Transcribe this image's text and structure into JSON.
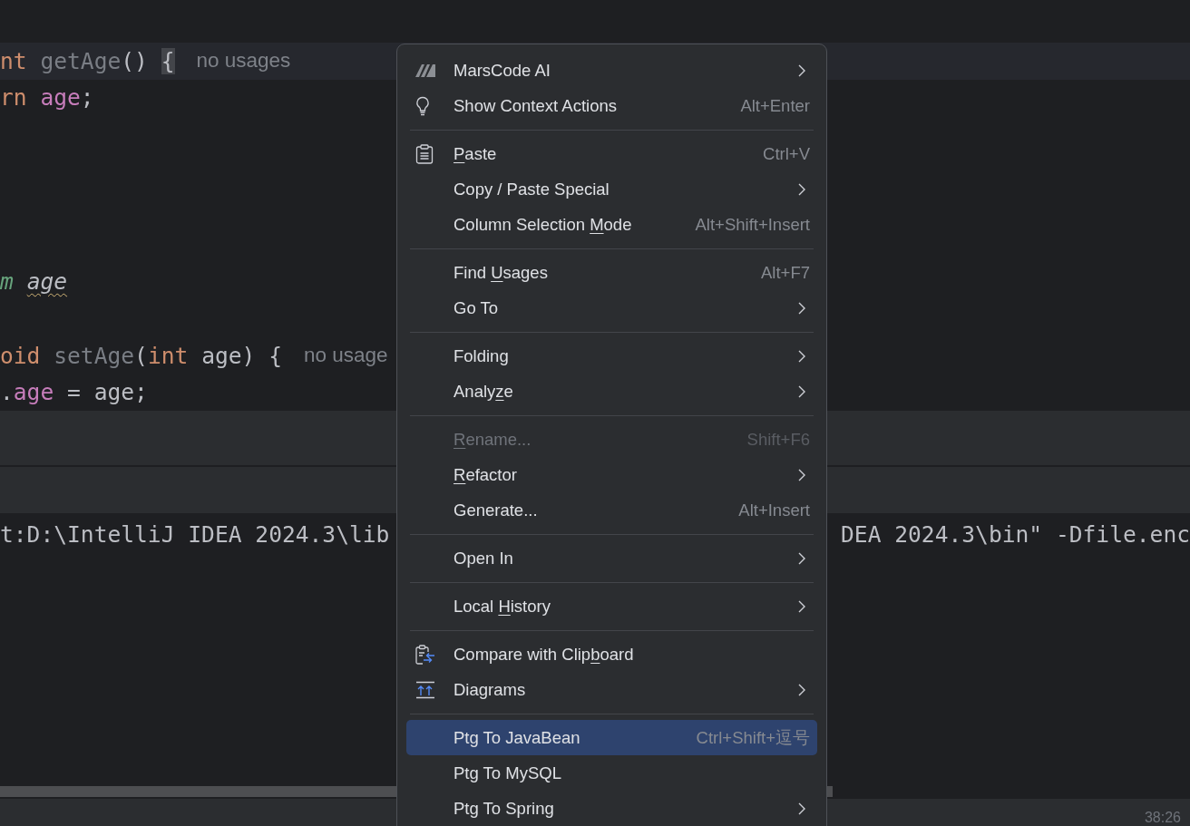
{
  "editor": {
    "lines": [
      {
        "kind": "code",
        "current": true,
        "tokens": [
          {
            "text": "nt ",
            "kind": "keyword"
          },
          {
            "text": "getAge",
            "kind": "unused"
          },
          {
            "text": "() ",
            "kind": "plain"
          },
          {
            "text": "{",
            "kind": "brace_match"
          }
        ],
        "hint": "no usages"
      },
      {
        "kind": "code",
        "current": false,
        "tokens": [
          {
            "text": "rn ",
            "kind": "keyword"
          },
          {
            "text": "age",
            "kind": "field"
          },
          {
            "text": ";",
            "kind": "plain"
          }
        ]
      },
      {
        "kind": "blank"
      },
      {
        "kind": "blank"
      },
      {
        "kind": "blank"
      },
      {
        "kind": "blank"
      },
      {
        "kind": "code",
        "current": false,
        "tokens": [
          {
            "text": "m ",
            "kind": "doc_tag"
          },
          {
            "text": "age",
            "kind": "doc_param_warning"
          }
        ]
      },
      {
        "kind": "blank"
      },
      {
        "kind": "code",
        "current": false,
        "tokens": [
          {
            "text": "oid ",
            "kind": "keyword"
          },
          {
            "text": "setAge",
            "kind": "unused"
          },
          {
            "text": "(",
            "kind": "plain"
          },
          {
            "text": "int ",
            "kind": "keyword"
          },
          {
            "text": "age) {",
            "kind": "plain"
          }
        ],
        "hint": "no usage"
      },
      {
        "kind": "code",
        "current": false,
        "tokens": [
          {
            "text": ".",
            "kind": "plain"
          },
          {
            "text": "age",
            "kind": "field"
          },
          {
            "text": " = age;",
            "kind": "plain"
          }
        ]
      }
    ]
  },
  "console": {
    "fragments": [
      "t:D:\\IntelliJ IDEA 2024.3\\lib",
      "DEA 2024.3\\bin\" -Dfile.enc"
    ]
  },
  "status_bar": {
    "position": "38:26"
  },
  "menu": {
    "groups": [
      {
        "items": [
          {
            "kind": "logo",
            "label": [
              {
                "text": "MarsCode AI",
                "underlined": false
              }
            ],
            "submenu": true,
            "disabled": false,
            "selected": false
          },
          {
            "kind": "bulb",
            "label": [
              {
                "text": "Show Context Actions",
                "underlined": false
              }
            ],
            "shortcut": "Alt+Enter",
            "submenu": false,
            "disabled": false,
            "selected": false
          }
        ]
      },
      {
        "items": [
          {
            "kind": "clipboard",
            "label": [
              {
                "text": "P",
                "underlined": true
              },
              {
                "text": "aste",
                "underlined": false
              }
            ],
            "shortcut": "Ctrl+V",
            "submenu": false,
            "disabled": false,
            "selected": false
          },
          {
            "kind": "plain",
            "label": [
              {
                "text": "Copy / Paste Special",
                "underlined": false
              }
            ],
            "submenu": true,
            "disabled": false,
            "selected": false
          },
          {
            "kind": "plain",
            "label": [
              {
                "text": "Column Selection ",
                "underlined": false
              },
              {
                "text": "M",
                "underlined": true
              },
              {
                "text": "ode",
                "underlined": false
              }
            ],
            "shortcut": "Alt+Shift+Insert",
            "submenu": false,
            "disabled": false,
            "selected": false
          }
        ]
      },
      {
        "items": [
          {
            "kind": "plain",
            "label": [
              {
                "text": "Find ",
                "underlined": false
              },
              {
                "text": "U",
                "underlined": true
              },
              {
                "text": "sages",
                "underlined": false
              }
            ],
            "shortcut": "Alt+F7",
            "submenu": false,
            "disabled": false,
            "selected": false
          },
          {
            "kind": "plain",
            "label": [
              {
                "text": "Go To",
                "underlined": false
              }
            ],
            "submenu": true,
            "disabled": false,
            "selected": false
          }
        ]
      },
      {
        "items": [
          {
            "kind": "plain",
            "label": [
              {
                "text": "Folding",
                "underlined": false
              }
            ],
            "submenu": true,
            "disabled": false,
            "selected": false
          },
          {
            "kind": "plain",
            "label": [
              {
                "text": "Analy",
                "underlined": false
              },
              {
                "text": "z",
                "underlined": true
              },
              {
                "text": "e",
                "underlined": false
              }
            ],
            "submenu": true,
            "disabled": false,
            "selected": false
          }
        ]
      },
      {
        "items": [
          {
            "kind": "plain",
            "label": [
              {
                "text": "R",
                "underlined": true
              },
              {
                "text": "ename...",
                "underlined": false
              }
            ],
            "shortcut": "Shift+F6",
            "submenu": false,
            "disabled": true,
            "selected": false
          },
          {
            "kind": "plain",
            "label": [
              {
                "text": "R",
                "underlined": true
              },
              {
                "text": "efactor",
                "underlined": false
              }
            ],
            "submenu": true,
            "disabled": false,
            "selected": false
          },
          {
            "kind": "plain",
            "label": [
              {
                "text": "Generate...",
                "underlined": false
              }
            ],
            "shortcut": "Alt+Insert",
            "submenu": false,
            "disabled": false,
            "selected": false
          }
        ]
      },
      {
        "items": [
          {
            "kind": "plain",
            "label": [
              {
                "text": "Open In",
                "underlined": false
              }
            ],
            "submenu": true,
            "disabled": false,
            "selected": false
          }
        ]
      },
      {
        "items": [
          {
            "kind": "plain",
            "label": [
              {
                "text": "Local ",
                "underlined": false
              },
              {
                "text": "H",
                "underlined": true
              },
              {
                "text": "istory",
                "underlined": false
              }
            ],
            "submenu": true,
            "disabled": false,
            "selected": false
          }
        ]
      },
      {
        "items": [
          {
            "kind": "compare",
            "label": [
              {
                "text": "Compare with Clip",
                "underlined": false
              },
              {
                "text": "b",
                "underlined": true
              },
              {
                "text": "oard",
                "underlined": false
              }
            ],
            "submenu": false,
            "disabled": false,
            "selected": false
          },
          {
            "kind": "diagram",
            "label": [
              {
                "text": "Diagrams",
                "underlined": false
              }
            ],
            "submenu": true,
            "disabled": false,
            "selected": false
          }
        ]
      },
      {
        "items": [
          {
            "kind": "plain",
            "label": [
              {
                "text": "Ptg To JavaBean",
                "underlined": false
              }
            ],
            "shortcut": "Ctrl+Shift+逗号",
            "submenu": false,
            "disabled": false,
            "selected": true
          },
          {
            "kind": "plain",
            "label": [
              {
                "text": "Ptg To MySQL",
                "underlined": false
              }
            ],
            "submenu": false,
            "disabled": false,
            "selected": false
          },
          {
            "kind": "plain",
            "label": [
              {
                "text": "Ptg To Spring",
                "underlined": false
              }
            ],
            "submenu": true,
            "disabled": false,
            "selected": false
          }
        ]
      }
    ]
  }
}
